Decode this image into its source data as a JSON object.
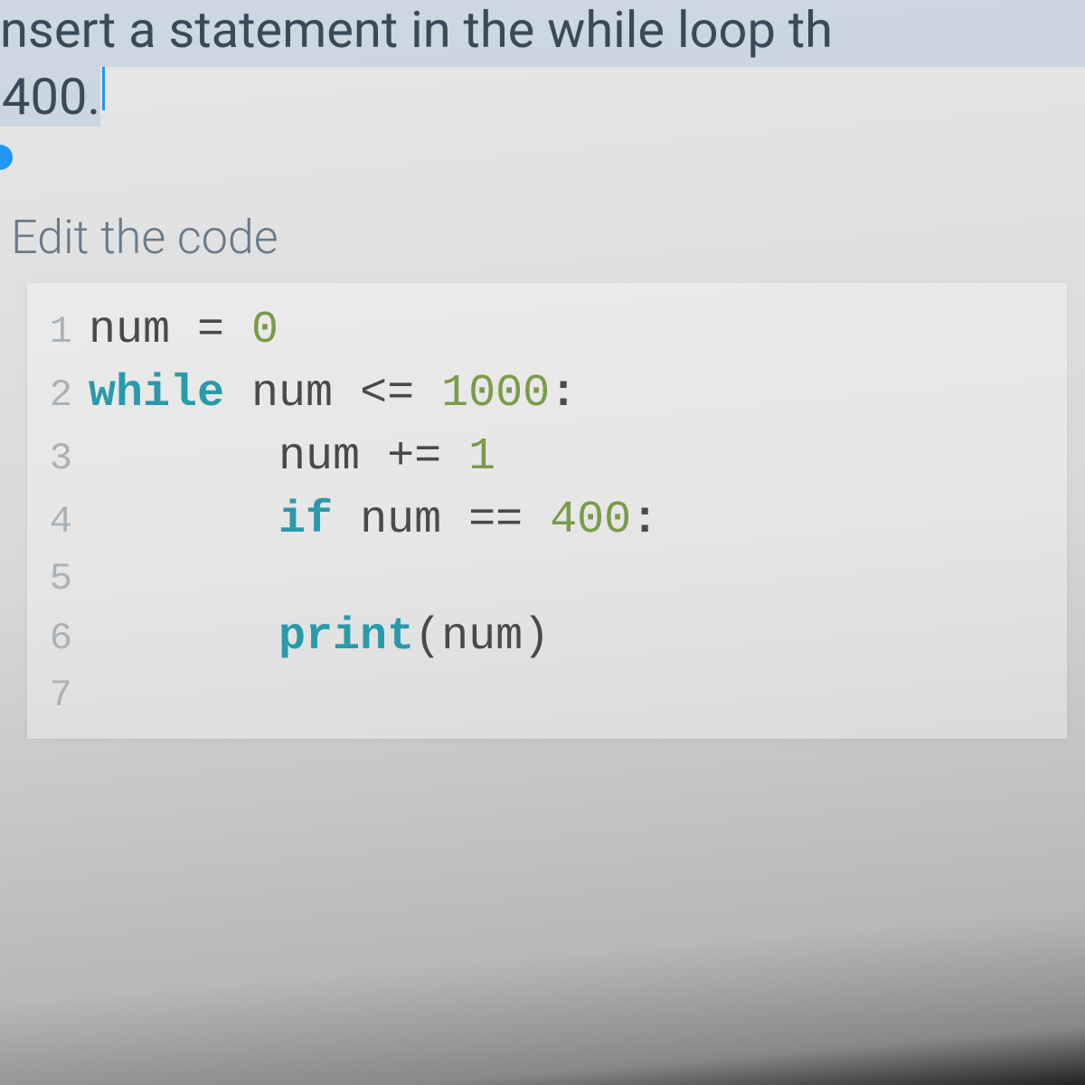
{
  "instruction": {
    "line1": "nsert a statement in the while loop th",
    "line2": "400."
  },
  "section_title": "Edit the code",
  "code": {
    "lines": [
      {
        "n": "1",
        "indent": 0,
        "tokens": [
          {
            "t": "num",
            "c": "var"
          },
          {
            "t": " = ",
            "c": "op"
          },
          {
            "t": "0",
            "c": "num"
          }
        ]
      },
      {
        "n": "2",
        "indent": 0,
        "tokens": [
          {
            "t": "while",
            "c": "kw"
          },
          {
            "t": " num ",
            "c": "var"
          },
          {
            "t": "<=",
            "c": "op"
          },
          {
            "t": " ",
            "c": "var"
          },
          {
            "t": "1000",
            "c": "num"
          },
          {
            "t": ":",
            "c": "punc"
          }
        ]
      },
      {
        "n": "3",
        "indent": 1,
        "tokens": [
          {
            "t": "num ",
            "c": "var"
          },
          {
            "t": "+=",
            "c": "op"
          },
          {
            "t": " ",
            "c": "var"
          },
          {
            "t": "1",
            "c": "num"
          }
        ]
      },
      {
        "n": "4",
        "indent": 1,
        "tokens": [
          {
            "t": "if",
            "c": "kw"
          },
          {
            "t": " num ",
            "c": "var"
          },
          {
            "t": "==",
            "c": "op"
          },
          {
            "t": " ",
            "c": "var"
          },
          {
            "t": "400",
            "c": "num"
          },
          {
            "t": ":",
            "c": "punc"
          }
        ]
      },
      {
        "n": "5",
        "indent": 0,
        "tokens": []
      },
      {
        "n": "6",
        "indent": 1,
        "tokens": [
          {
            "t": "print",
            "c": "func"
          },
          {
            "t": "(",
            "c": "paren"
          },
          {
            "t": "num",
            "c": "var"
          },
          {
            "t": ")",
            "c": "paren"
          }
        ]
      },
      {
        "n": "7",
        "indent": 0,
        "tokens": []
      }
    ],
    "indent_unit": "       "
  }
}
